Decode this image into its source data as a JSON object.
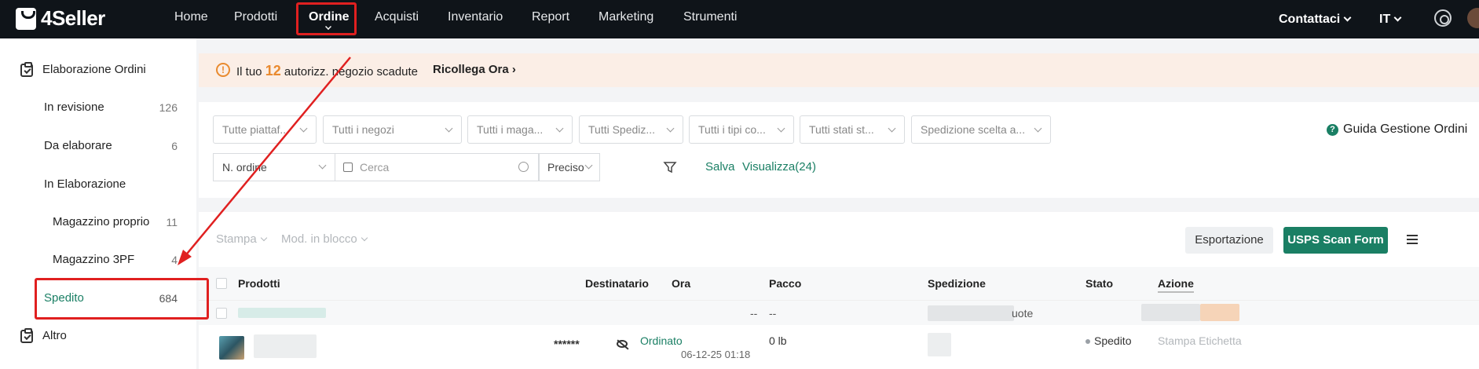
{
  "app": {
    "logo_text": "4Seller"
  },
  "nav": {
    "items": [
      "Home",
      "Prodotti",
      "Ordine",
      "Acquisti",
      "Inventario",
      "Report",
      "Marketing",
      "Strumenti"
    ],
    "contact": "Contattaci",
    "lang": "IT"
  },
  "sidebar": {
    "section": "Elaborazione Ordini",
    "items": [
      {
        "label": "In revisione",
        "count": "126"
      },
      {
        "label": "Da elaborare",
        "count": "6"
      },
      {
        "label": "In Elaborazione",
        "count": ""
      },
      {
        "label": "Magazzino proprio",
        "count": "11"
      },
      {
        "label": "Magazzino 3PF",
        "count": "4"
      },
      {
        "label": "Spedito",
        "count": "684"
      }
    ],
    "other": "Altro"
  },
  "alert": {
    "prefix": "Il tuo",
    "number": "12",
    "suffix": "autorizz. negozio scadute",
    "link": "Ricollega Ora"
  },
  "filters": {
    "selects": [
      "Tutte piattaf...",
      "Tutti i negozi",
      "Tutti i maga...",
      "Tutti Spediz...",
      "Tutti i tipi co...",
      "Tutti stati st...",
      "Spedizione scelta a..."
    ],
    "help": "Guida Gestione Ordini",
    "search_field": "N. ordine",
    "search_placeholder": "Cerca",
    "match": "Preciso",
    "save": "Salva",
    "view": "Visualizza(24)"
  },
  "toolbar": {
    "print": "Stampa",
    "bulk": "Mod. in blocco",
    "export": "Esportazione",
    "usps": "USPS Scan Form"
  },
  "table": {
    "headers": [
      "Prodotti",
      "Destinatario",
      "Ora",
      "Pacco",
      "Spedizione",
      "Stato",
      "Azione"
    ],
    "group_row": {
      "dash1": "--",
      "dash2": "--",
      "shipping_tail": "uote"
    },
    "row": {
      "recipient": "******",
      "time_label": "Ordinato",
      "time_value": "06-12-25 01:18",
      "package": "0 lb",
      "status": "Spedito",
      "action": "Stampa Etichetta"
    }
  },
  "colors": {
    "brand_green": "#1a7f64",
    "nav_bg": "#0f1419",
    "alert_orange": "#e98a2e",
    "annotation_red": "#e02020"
  }
}
